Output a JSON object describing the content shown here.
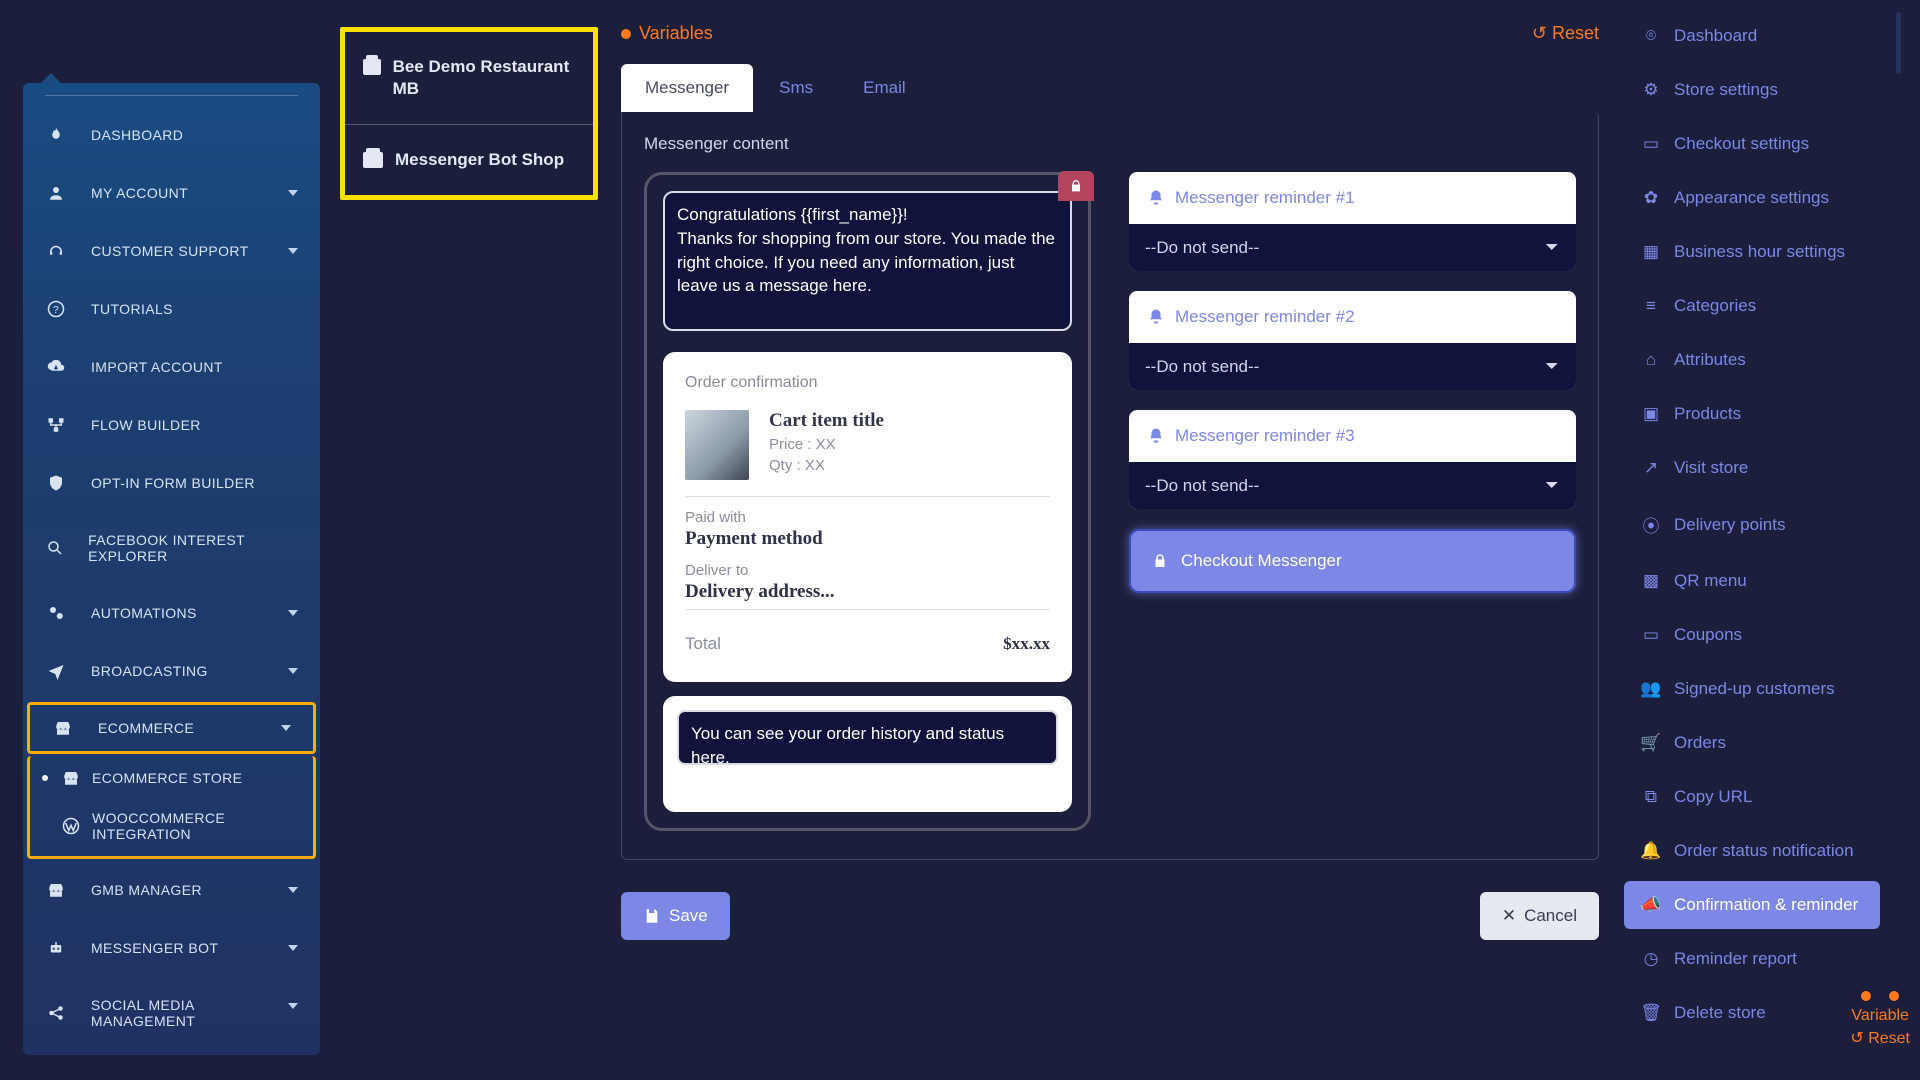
{
  "sidebar": {
    "items": [
      {
        "label": "DASHBOARD",
        "icon": "flame",
        "caret": false
      },
      {
        "label": "MY ACCOUNT",
        "icon": "user",
        "caret": true
      },
      {
        "label": "CUSTOMER SUPPORT",
        "icon": "headset",
        "caret": true
      },
      {
        "label": "TUTORIALS",
        "icon": "help",
        "caret": false
      },
      {
        "label": "IMPORT ACCOUNT",
        "icon": "cloud-down",
        "caret": false
      },
      {
        "label": "FLOW BUILDER",
        "icon": "flow",
        "caret": false
      },
      {
        "label": "OPT-IN FORM BUILDER",
        "icon": "shield",
        "caret": false
      },
      {
        "label": "FACEBOOK INTEREST EXPLORER",
        "icon": "search",
        "caret": false
      },
      {
        "label": "AUTOMATIONS",
        "icon": "gears",
        "caret": true
      },
      {
        "label": "BROADCASTING",
        "icon": "send",
        "caret": true
      }
    ],
    "ecommerce": {
      "label": "ECOMMERCE",
      "icon": "store",
      "caret": true
    },
    "ecommerce_sub": [
      {
        "label": "ECOMMERCE STORE",
        "icon": "store"
      },
      {
        "label": "WOOCCOMMERCE INTEGRATION",
        "icon": "wp"
      }
    ],
    "post": [
      {
        "label": "GMB MANAGER",
        "icon": "store",
        "caret": true
      },
      {
        "label": "MESSENGER BOT",
        "icon": "robot",
        "caret": true
      },
      {
        "label": "SOCIAL MEDIA MANAGEMENT",
        "icon": "share",
        "caret": true
      }
    ]
  },
  "stores": [
    {
      "name": "Bee Demo Restaurant MB"
    },
    {
      "name": "Messenger Bot Shop"
    }
  ],
  "top": {
    "variables": "Variables",
    "reset": "Reset"
  },
  "tabs": {
    "messenger": "Messenger",
    "sms": "Sms",
    "email": "Email"
  },
  "panel": {
    "heading": "Messenger content",
    "msg1": "Congratulations {{first_name}}!\nThanks for shopping from our store. You made the right choice. If you need any information, just leave us a message here.",
    "order_confirmation": "Order confirmation",
    "cart_title": "Cart item title",
    "price": "Price : XX",
    "qty": "Qty : XX",
    "paid_with_label": "Paid with",
    "payment_method": "Payment method",
    "deliver_to_label": "Deliver to",
    "delivery_address": "Delivery address...",
    "total_label": "Total",
    "total_value": "$xx.xx",
    "msg2": "You can see your order history and status here."
  },
  "reminders": [
    {
      "label": "Messenger reminder #1",
      "selected": "--Do not send--"
    },
    {
      "label": "Messenger reminder #2",
      "selected": "--Do not send--"
    },
    {
      "label": "Messenger reminder #3",
      "selected": "--Do not send--"
    }
  ],
  "checkout_messenger": "Checkout Messenger",
  "actions": {
    "save": "Save",
    "cancel": "Cancel"
  },
  "rightbar": [
    {
      "label": "Dashboard",
      "icon": "gauge"
    },
    {
      "label": "Store settings",
      "icon": "gear"
    },
    {
      "label": "Checkout settings",
      "icon": "card"
    },
    {
      "label": "Appearance settings",
      "icon": "palette"
    },
    {
      "label": "Business hour settings",
      "icon": "calendar"
    },
    {
      "label": "Categories",
      "icon": "list"
    },
    {
      "label": "Attributes",
      "icon": "tag"
    },
    {
      "label": "Products",
      "icon": "box"
    },
    {
      "label": "Visit store",
      "icon": "external"
    },
    {
      "label": "Delivery points",
      "icon": "pin"
    },
    {
      "label": "QR menu",
      "icon": "qr"
    },
    {
      "label": "Coupons",
      "icon": "ticket"
    },
    {
      "label": "Signed-up customers",
      "icon": "users"
    },
    {
      "label": "Orders",
      "icon": "cart"
    },
    {
      "label": "Copy URL",
      "icon": "copy"
    },
    {
      "label": "Order status notification",
      "icon": "bell"
    },
    {
      "label": "Confirmation & reminder",
      "icon": "megaphone",
      "active": true
    },
    {
      "label": "Reminder report",
      "icon": "clock"
    },
    {
      "label": "Delete store",
      "icon": "trash"
    }
  ],
  "float": {
    "line1": "Variable",
    "line2": "Reset"
  }
}
